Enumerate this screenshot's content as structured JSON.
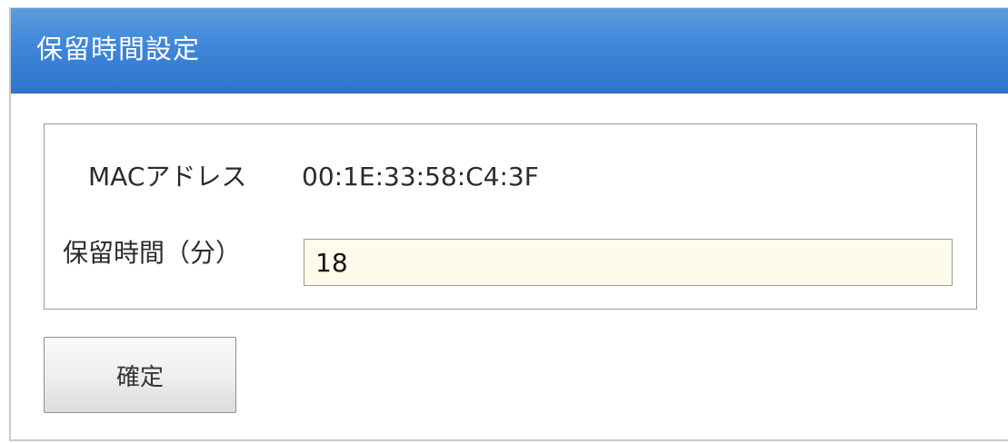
{
  "dialog": {
    "title": "保留時間設定"
  },
  "form": {
    "mac_label": "MACアドレス",
    "mac_value": "00:1E:33:58:C4:3F",
    "hold_time_label": "保留時間（分）",
    "hold_time_value": "18"
  },
  "actions": {
    "confirm_label": "確定"
  },
  "colors": {
    "titlebar": "#3f86d8",
    "input_background": "#fffbea"
  }
}
